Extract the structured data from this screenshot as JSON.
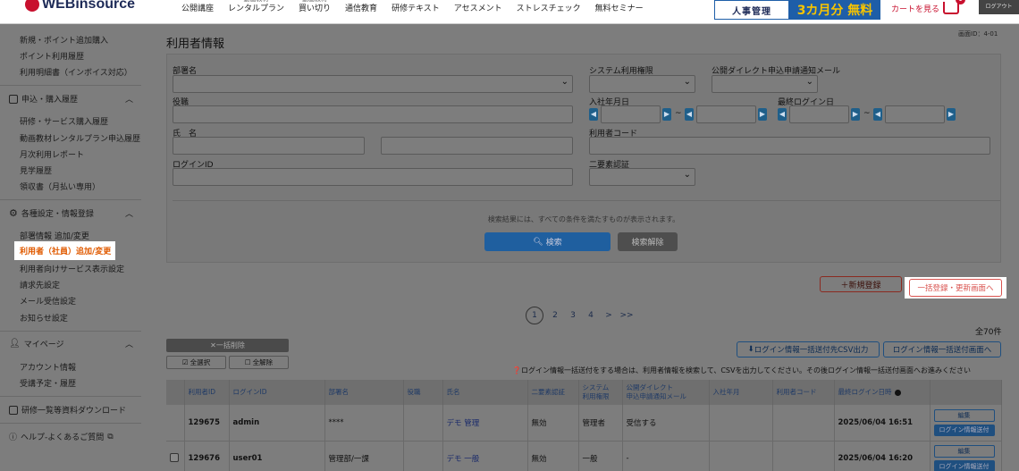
{
  "header": {
    "logo": "WEBinsource",
    "nav": [
      {
        "top": "",
        "label": "公開講座"
      },
      {
        "top": "動画教材",
        "label": "レンタルプラン"
      },
      {
        "top": "動画教材",
        "label": "買い切り"
      },
      {
        "top": "",
        "label": "通信教育"
      },
      {
        "top": "",
        "label": "研修テキスト"
      },
      {
        "top": "",
        "label": "アセスメント"
      },
      {
        "top": "",
        "label": "ストレスチェック"
      },
      {
        "top": "",
        "label": "無料セミナー"
      }
    ],
    "banner1": "人事管理",
    "banner2": "3カ月分 無料",
    "cart_label": "カートを見る",
    "cart_count": "1",
    "logout": "ログアウト"
  },
  "sidebar": {
    "links_top": [
      "新規・ポイント追加購入",
      "ポイント利用履歴",
      "利用明細書（インボイス対応）"
    ],
    "section1": "申込・購入履歴",
    "links1": [
      "研修・サービス購入履歴",
      "動画教材レンタルプラン申込履歴",
      "月次利用レポート",
      "見学履歴",
      "領収書（月払い専用）"
    ],
    "section2": "各種設定・情報登録",
    "links2": [
      "部署情報 追加/変更",
      "利用者（社員）追加/変更",
      "利用者向けサービス表示設定",
      "請求先設定",
      "メール受信設定",
      "お知らせ設定"
    ],
    "section3": "マイページ",
    "links3": [
      "アカウント情報",
      "受講予定・履歴"
    ],
    "section4": "研修一覧等資料ダウンロード",
    "section5": "ヘルプ-よくあるご質問"
  },
  "page": {
    "title": "利用者情報",
    "screen_id": "画面ID：4-01"
  },
  "search": {
    "label_dept": "部署名",
    "label_role": "役職",
    "label_name": "氏　名",
    "label_login": "ログインID",
    "label_sysperm": "システム利用権限",
    "label_direct": "公開ダイレクト申込申請通知メール",
    "label_joined": "入社年月日",
    "label_lastlogin": "最終ログイン日",
    "label_usercode": "利用者コード",
    "label_2fa": "二要素認証",
    "note": "検索結果には、すべての条件を満たすものが表示されます。",
    "search_btn": "検索",
    "clear_btn": "検索解除"
  },
  "actions": {
    "new_btn": "＋新規登録",
    "bulk_btn": "一括登録・更新画面へ",
    "delete_btn": "✕一括削除",
    "select_all": "全選択",
    "deselect_all": "全解除",
    "csv_btn": "ログイン情報一括送付先CSV出力",
    "send_btn": "ログイン情報一括送付画面へ",
    "csv_note": "ログイン情報一括送付をする場合は、利用者情報を検索して、CSVを出力してください。その後ログイン情報一括送付画面へお進みください"
  },
  "pagination": {
    "pages": [
      "1",
      "2",
      "3",
      "4",
      ">",
      ">>"
    ],
    "current": "1",
    "total": "全70件"
  },
  "table": {
    "headers": [
      "",
      "利用者ID",
      "ログインID",
      "部署名",
      "役職",
      "氏名",
      "二要素認証",
      "システム\n利用権限",
      "公開ダイレクト\n申込申請通知メール",
      "入社年月",
      "利用者コード",
      "最終ログイン日時",
      ""
    ],
    "edit_label": "編集",
    "send_label": "ログイン情報送付",
    "rows": [
      {
        "id": "129675",
        "login": "admin",
        "dept": "****",
        "role": "",
        "name": "デモ 管理",
        "twofa": "無効",
        "perm": "管理者",
        "mail": "受信する",
        "joined": "",
        "code": "",
        "last": "2025/06/04 16:51"
      },
      {
        "id": "129676",
        "login": "user01",
        "dept": "管理部/一課",
        "role": "",
        "name": "デモ 一般",
        "twofa": "無効",
        "perm": "一般",
        "mail": "-",
        "joined": "",
        "code": "",
        "last": "2025/06/04 16:20"
      }
    ]
  }
}
